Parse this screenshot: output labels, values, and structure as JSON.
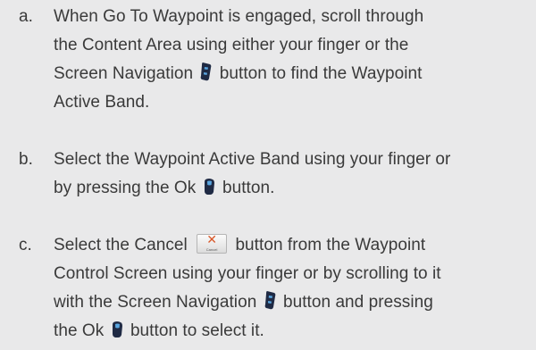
{
  "steps": [
    {
      "letter": "a.",
      "lines": [
        [
          "When Go To Waypoint is engaged, scroll through"
        ],
        [
          "the Content Area using either your finger or the"
        ],
        [
          "Screen Navigation",
          "button to find the Waypoint"
        ],
        [
          "Active Band."
        ]
      ]
    },
    {
      "letter": "b.",
      "lines": [
        [
          "Select the Waypoint Active Band using your finger or"
        ],
        [
          "by pressing the Ok",
          "button."
        ]
      ]
    },
    {
      "letter": "c.",
      "lines": [
        [
          "Select the Cancel",
          "button from the Waypoint"
        ],
        [
          "Control Screen using your finger or by scrolling to it"
        ],
        [
          "with the Screen Navigation",
          "button and pressing"
        ],
        [
          "the Ok",
          "button to select it."
        ]
      ]
    }
  ],
  "icons": {
    "nav_button": "screen-navigation-button-icon",
    "ok_button": "ok-button-icon",
    "cancel_button_caption": "Cancel",
    "cancel_button_glyph": "✕",
    "icon_dark": "#1f2a44",
    "icon_light": "#5aa6e0",
    "cancel_x_color": "#d8582a"
  }
}
